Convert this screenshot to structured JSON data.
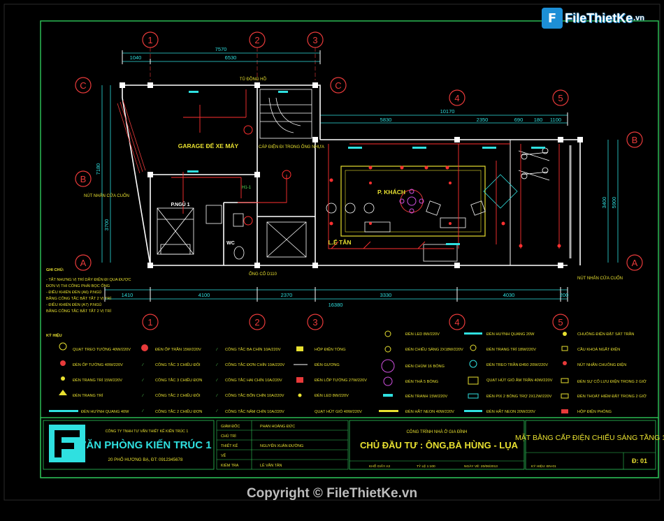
{
  "watermark": {
    "brand": "FileThietKe",
    "suffix": ".vn",
    "icon": "file-logo-icon"
  },
  "grid": {
    "top": [
      "1",
      "2",
      "3",
      "4",
      "5"
    ],
    "bottom": [
      "1",
      "2",
      "3",
      "4",
      "5"
    ],
    "left": [
      "C",
      "B",
      "A"
    ],
    "right": [
      "C",
      "B",
      "A"
    ]
  },
  "dims": {
    "total_top": "7570",
    "d1": "1040",
    "d2": "6530",
    "right_total": "10170",
    "r_seg": [
      "5830",
      "2350",
      "690",
      "180",
      "1100"
    ],
    "bottom": [
      "1410",
      "4100",
      "2370",
      "3330",
      "4030",
      "200"
    ],
    "overall": "16380",
    "left_1": "7180",
    "left_2": "3700",
    "right_1": "3400",
    "right_2": "5900"
  },
  "rooms": {
    "garage": "GARAGE ĐỂ XE MÁY",
    "bedroom": "P.NGỦ 1",
    "living": "P. KHÁCH",
    "hall": "L.Ể TÂN",
    "wc": "WC"
  },
  "labels": {
    "stair_note": "TỦ ĐỒNG HỒ",
    "panel": "HỘP ĐIỆN TỔNG",
    "cable_note": "CÁP ĐIỆN ĐI TRONG ỐNG NHỰA",
    "bell1": "NÚT NHẤN CỬA CUỐN",
    "bell2": "NÚT NHẤN CỬA CUỐN",
    "pipe": "ỐNG CỐ D110",
    "circuit": "H1-1"
  },
  "notes": {
    "title": "GHI CHÚ:",
    "lines": [
      "- TẤT NHƯNG VỊ TRÍ DÂY ĐIỆN ĐI QUA ĐƯỢC",
      "  ĐƠN VỊ THI CÔNG PHẢI BỌC ỐNG",
      "- ĐIỀU KHIỂN ĐÈN (A6) P.NGỦ",
      "  BẰNG CÔNG TẮC BẬT TẮT 2 VỊ TRÍ",
      "- ĐIỀU KHIỂN ĐÈN (A7) P.NGỦ",
      "  BẰNG CÔNG TẮC BẬT TẮT 2 VỊ TRÍ"
    ]
  },
  "legend": {
    "title": "KÝ HIỆU",
    "col1": [
      "QUẠT TREO TƯỜNG 40W/220V",
      "ĐÈN ỐP TƯỜNG 40W/220V",
      "ĐÈN TRANG TRÍ 15W/220V",
      "ĐÈN TRANG TRÍ",
      "ĐÈN HUỲNH QUANG 40W"
    ],
    "col2": [
      "ĐÈN ỐP TRẦN 15W/220V",
      "CÔNG TẮC 3 CHIỀU ĐÔI",
      "CÔNG TẮC 3 CHIỀU ĐƠN",
      "CÔNG TẮC 2 CHIỀU ĐÔI",
      "CÔNG TẮC 2 CHIỀU ĐƠN"
    ],
    "col3": [
      "CÔNG TẮC BA CHÍN 10A/220V",
      "CÔNG TẮC ĐƠN CHÍN 10A/220V",
      "CÔNG TẮC HAI CHÍN 10A/220V",
      "CÔNG TẮC BỐN CHÍN 10A/220V",
      "CÔNG TẮC NĂM CHÍN 10A/220V"
    ],
    "col4": [
      "HỘP ĐIỆN TỔNG",
      "ĐÈN GƯƠNG",
      "ĐÈN LỐP TƯỜNG 27W/220V",
      "ĐÈN LED 8W/220V",
      "QUẠT HÚT GIÓ 40W/220V"
    ],
    "col5": [
      "ĐÈN LED 8W/220V",
      "ĐÈN CHIẾU SÁNG 2X18W/220V",
      "ĐÈN CHÙM 16 BÓNG",
      "ĐÈN THẢ 5 BÓNG",
      "ĐÈN TRANH 15W/220V",
      "ĐÈN HẮT NEON 40W/220V"
    ],
    "col6": [
      "ĐÈN HUỲNH QUANG 20W",
      "ĐÈN TRANG TRÍ 18W/220V",
      "ĐÈN TREO TRẦN Đ450 20W/220V",
      "QUẠT HÚT GIÓ ÂM TRẦN 40W/220V",
      "ĐÈN PIX 2 BÓNG TRỢ 2X12W/220V",
      "ĐÈN HẮT NEON 20W/220V"
    ],
    "col7": [
      "CHUÔNG ĐIỆN ĐẶT SÁT TRẦN",
      "CẦU KHOÁ NGẮT ĐIỆN",
      "NÚT NHẤN CHUÔNG ĐIỆN",
      "ĐÈN SỰ CỐ LƯU ĐIỆN TRONG 2 GIỜ",
      "ĐÈN THOÁT HIỂM ĐẶT TRONG 2 GIỜ",
      "HỘP ĐIỆN PHÒNG"
    ]
  },
  "title_block": {
    "company_small": "CÔNG TY TNHH TƯ VẤN THIẾT KẾ KIẾN TRÚC 1",
    "company": "VĂN PHÒNG KIẾN TRÚC 1",
    "address": "20 PHỐ HƯƠNG BẠ, ĐT: 0912345678",
    "roles": [
      "GIÁM ĐỐC",
      "CHỦ TRÌ",
      "THIẾT KẾ",
      "VẼ",
      "KIỂM TRA"
    ],
    "names": [
      "PHAN HOÀNG ĐỨC",
      "",
      "NGUYỄN XUÂN ĐƯỜNG",
      "",
      "LÊ VĂN TÂN"
    ],
    "project_small": "CÔNG TRÌNH NHÀ Ở GIA ĐÌNH",
    "owner": "CHỦ ĐẦU TƯ : ÔNG,BÀ HÙNG - LỤA",
    "footer": [
      "KHỔ GIẤY A3",
      "TỶ LỆ 1:100",
      "NGÀY VẼ: 20/06/2013"
    ],
    "drawing_title": "MẶT BẰNG CẤP ĐIỆN CHIẾU SÁNG TẦNG 1",
    "drawing_code": "KÝ HIỆU: ĐN-01",
    "sheet": "Đ: 01"
  },
  "footer": {
    "copyright": "Copyright © FileThietKe.vn"
  },
  "colors": {
    "bg": "#000000",
    "grid_bubble": "#e83a3a",
    "dimension": "#2fe0e0",
    "frame": "#2fc85a",
    "wall": "#ffffff",
    "accent": "#e8e030",
    "wire": "#ff3030",
    "title": "#e8e030",
    "text_label": "#5ee85e"
  }
}
